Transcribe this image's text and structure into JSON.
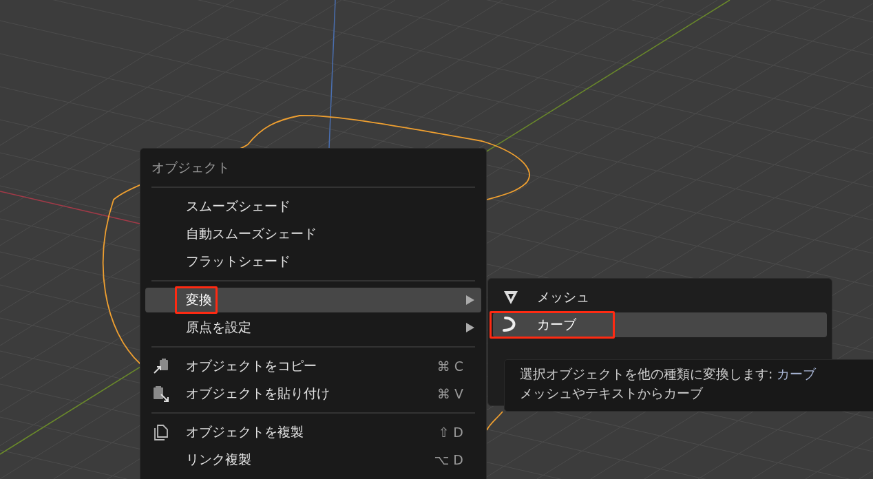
{
  "menu": {
    "title": "オブジェクト",
    "sections": [
      {
        "items": [
          {
            "label": "スムーズシェード",
            "selected": false,
            "submenu": false,
            "annotated": false
          },
          {
            "label": "自動スムーズシェード",
            "selected": false,
            "submenu": false,
            "annotated": false
          },
          {
            "label": "フラットシェード",
            "selected": false,
            "submenu": false,
            "annotated": false
          }
        ]
      },
      {
        "items": [
          {
            "label": "変換",
            "selected": true,
            "submenu": true,
            "annotated": true
          },
          {
            "label": "原点を設定",
            "selected": false,
            "submenu": true,
            "annotated": false
          }
        ]
      },
      {
        "items": [
          {
            "label": "オブジェクトをコピー",
            "shortcut": "⌘ C",
            "selected": false,
            "submenu": false,
            "annotated": false
          },
          {
            "label": "オブジェクトを貼り付け",
            "shortcut": "⌘ V",
            "selected": false,
            "submenu": false,
            "annotated": false
          }
        ]
      },
      {
        "items": [
          {
            "label": "オブジェクトを複製",
            "shortcut": "⇧ D",
            "selected": false,
            "submenu": false,
            "annotated": false
          },
          {
            "label": "リンク複製",
            "shortcut": "⌥ D",
            "selected": false,
            "submenu": false,
            "annotated": false
          }
        ]
      }
    ]
  },
  "submenu": {
    "items": [
      {
        "label": "メッシュ",
        "selected": false,
        "annotated": false
      },
      {
        "label": "カーブ",
        "selected": true,
        "annotated": true
      }
    ]
  },
  "tooltip": {
    "description": "選択オブジェクトを他の種類に変換します:",
    "term": "カーブ",
    "detail": "メッシュやテキストからカーブ"
  }
}
